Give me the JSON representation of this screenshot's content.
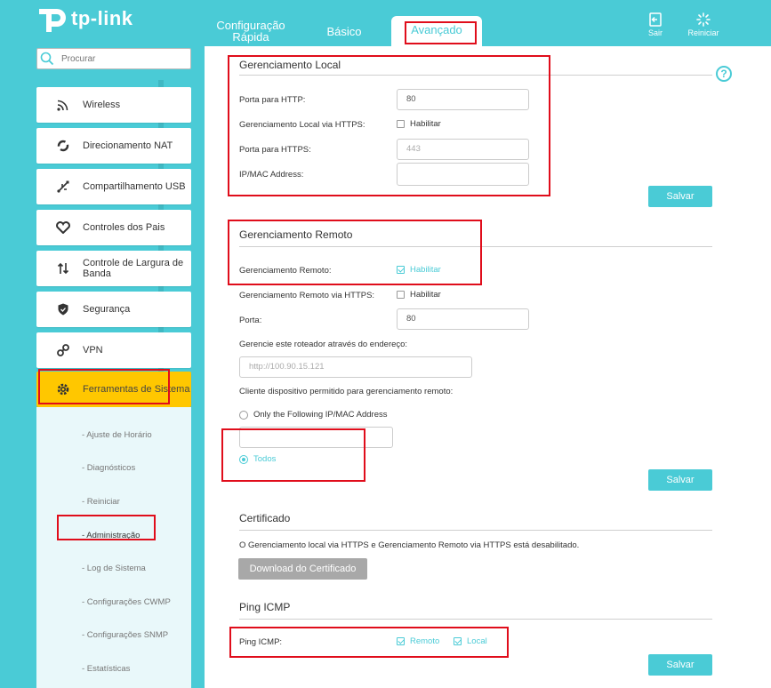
{
  "brand": {
    "name": "tp-link"
  },
  "header": {
    "tabs": [
      {
        "label_line1": "Configuração",
        "label_line2": "Rápida"
      },
      {
        "label": "Básico"
      },
      {
        "label": "Avançado"
      }
    ],
    "logout_label": "Sair",
    "reboot_label": "Reiniciar"
  },
  "sidebar": {
    "search_placeholder": "Procurar",
    "items": [
      {
        "label": "Wireless",
        "icon": "wifi-icon"
      },
      {
        "label": "Direcionamento NAT",
        "icon": "nat-forwarding-icon"
      },
      {
        "label": "Compartilhamento USB",
        "icon": "usb-icon"
      },
      {
        "label": "Controles dos Pais",
        "icon": "heart-icon"
      },
      {
        "label": "Controle de Largura de Banda",
        "icon": "bandwidth-arrows-icon"
      },
      {
        "label": "Segurança",
        "icon": "shield-icon"
      },
      {
        "label": "VPN",
        "icon": "vpn-link-icon"
      },
      {
        "label": "Ferramentas de Sistema",
        "icon": "gear-icon"
      }
    ],
    "subitems": [
      "- Ajuste de Horário",
      "- Diagnósticos",
      "- Reiniciar",
      "- Administração",
      "- Log de Sistema",
      "- Configurações CWMP",
      "- Configurações SNMP",
      "- Estatísticas"
    ]
  },
  "local_mgmt": {
    "title": "Gerenciamento Local",
    "http_port_label": "Porta para HTTP:",
    "http_port_value": "80",
    "https_label": "Gerenciamento Local via HTTPS:",
    "https_enable": "Habilitar",
    "https_port_label": "Porta para HTTPS:",
    "https_port_value": "443",
    "ipmac_label": "IP/MAC Address:",
    "ipmac_value": "",
    "save": "Salvar"
  },
  "remote_mgmt": {
    "title": "Gerenciamento Remoto",
    "remote_label": "Gerenciamento Remoto:",
    "remote_enable": "Habilitar",
    "remote_https_label": "Gerenciamento Remoto via HTTPS:",
    "remote_https_enable": "Habilitar",
    "port_label": "Porta:",
    "port_value": "80",
    "address_label": "Gerencie este roteador através do endereço:",
    "address_value": "http://100.90.15.121",
    "allowed_label": "Cliente dispositivo permitido para gerenciamento remoto:",
    "option_following": "Only the Following IP/MAC Address",
    "following_value": "",
    "option_all": "Todos",
    "save": "Salvar"
  },
  "certificate": {
    "title": "Certificado",
    "note": "O Gerenciamento local via HTTPS e Gerenciamento Remoto via HTTPS está desabilitado.",
    "download": "Download do Certificado"
  },
  "icmp": {
    "title": "Ping ICMP",
    "ping_label": "Ping ICMP:",
    "remote": "Remoto",
    "local": "Local",
    "save": "Salvar"
  },
  "colors": {
    "accent": "#4acbd6",
    "active": "#ffc700",
    "highlight": "#e00d1b"
  }
}
